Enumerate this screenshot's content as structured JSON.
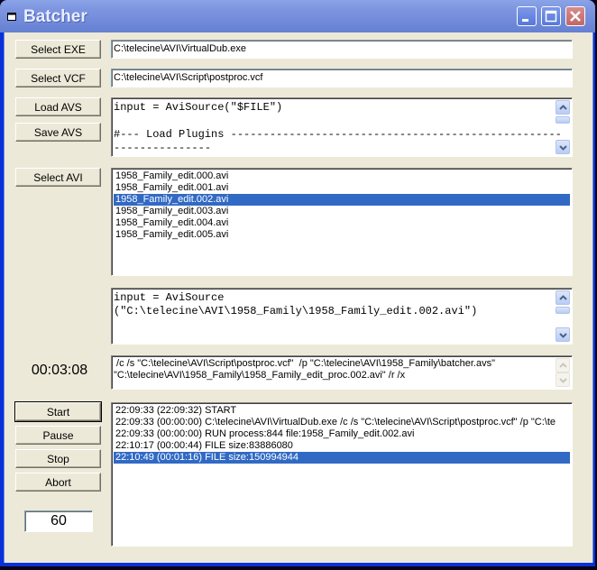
{
  "window": {
    "title": "Batcher"
  },
  "buttons": {
    "select_exe": "Select EXE",
    "select_vcf": "Select VCF",
    "load_avs": "Load AVS",
    "save_avs": "Save AVS",
    "select_avi": "Select AVI",
    "start": "Start",
    "pause": "Pause",
    "stop": "Stop",
    "abort": "Abort"
  },
  "fields": {
    "exe_path": "C:\\telecine\\AVI\\VirtualDub.exe",
    "vcf_path": "C:\\telecine\\AVI\\Script\\postproc.vcf",
    "avs_template": "input = AviSource(\"$FILE\")\n\n#--- Load Plugins ---------------------------------------------------\n---------------",
    "avs_resolved": "input = AviSource\n(\"C:\\telecine\\AVI\\1958_Family\\1958_Family_edit.002.avi\")",
    "command_line": " /c /s \"C:\\telecine\\AVI\\Script\\postproc.vcf\"  /p \"C:\\telecine\\AVI\\1958_Family\\batcher.avs\"\n\"C:\\telecine\\AVI\\1958_Family\\1958_Family_edit_proc.002.avi\" /r /x",
    "interval": "60"
  },
  "timer": "00:03:08",
  "avi_files": [
    {
      "name": "1958_Family_edit.000.avi",
      "selected": false
    },
    {
      "name": "1958_Family_edit.001.avi",
      "selected": false
    },
    {
      "name": "1958_Family_edit.002.avi",
      "selected": true
    },
    {
      "name": "1958_Family_edit.003.avi",
      "selected": false
    },
    {
      "name": "1958_Family_edit.004.avi",
      "selected": false
    },
    {
      "name": "1958_Family_edit.005.avi",
      "selected": false
    }
  ],
  "log": [
    {
      "text": "22:09:33 (22:09:32) START",
      "selected": false
    },
    {
      "text": "22:09:33 (00:00:00) C:\\telecine\\AVI\\VirtualDub.exe  /c /s \"C:\\telecine\\AVI\\Script\\postproc.vcf\"  /p \"C:\\te",
      "selected": false
    },
    {
      "text": "22:09:33 (00:00:00) RUN process:844 file:1958_Family_edit.002.avi",
      "selected": false
    },
    {
      "text": "22:10:17 (00:00:44) FILE size:83886080",
      "selected": false
    },
    {
      "text": "22:10:49 (00:01:16) FILE size:150994944",
      "selected": true
    }
  ],
  "colors": {
    "selection": "#316ac5",
    "face": "#ece9d8"
  }
}
